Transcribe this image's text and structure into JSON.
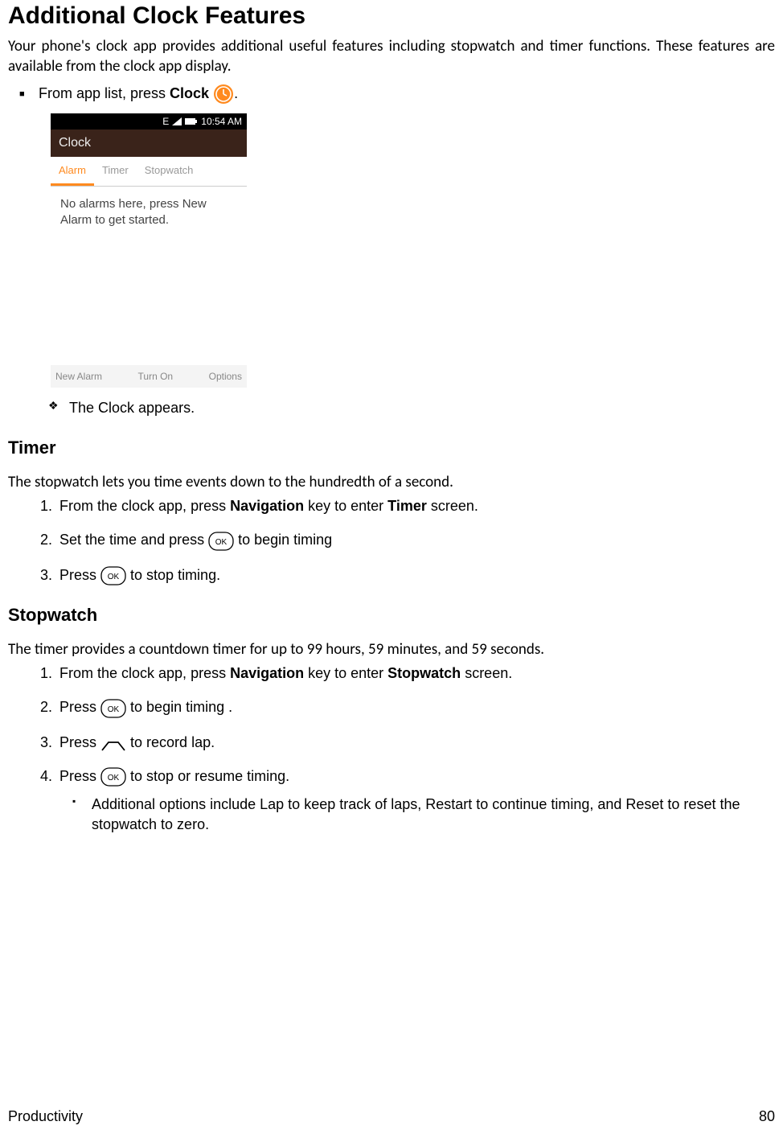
{
  "heading": "Additional Clock Features",
  "intro": "Your phone's clock app provides additional useful features including stopwatch and timer functions. These features are available from the clock app display.",
  "bullet_open_prefix": "From app list, press ",
  "bullet_open_bold": "Clock",
  "bullet_open_suffix": ".",
  "result1": "The Clock appears.",
  "mock": {
    "status_indicator": "E",
    "time": "10:54 AM",
    "title": "Clock",
    "tabs": [
      "Alarm",
      "Timer",
      "Stopwatch"
    ],
    "body": "No alarms here, press New Alarm to get started.",
    "softkeys": [
      "New Alarm",
      "Turn On",
      "Options"
    ]
  },
  "timer": {
    "heading": "Timer",
    "intro": "The stopwatch lets you time events down to the hundredth of a second.",
    "step1_a": "From the clock app, press ",
    "step1_b": "Navigation",
    "step1_c": " key to enter ",
    "step1_d": "Timer",
    "step1_e": " screen.",
    "step2_a": "Set the time and press ",
    "step2_b": " to begin timing",
    "step3_a": "Press ",
    "step3_b": " to stop timing."
  },
  "stopwatch": {
    "heading": "Stopwatch",
    "intro": "The timer provides a countdown timer for up to 99 hours, 59 minutes, and 59 seconds.",
    "step1_a": "From the clock app, press ",
    "step1_b": "Navigation",
    "step1_c": " key to enter ",
    "step1_d": "Stopwatch",
    "step1_e": " screen.",
    "step2_a": "Press ",
    "step2_b": " to begin timing .",
    "step3_a": "Press ",
    "step3_b": " to record lap.",
    "step4_a": "Press ",
    "step4_b": " to stop or resume timing.",
    "sub": "Additional options include Lap to keep track of laps, Restart to continue timing, and Reset to reset the stopwatch to zero."
  },
  "footer_left": "Productivity",
  "footer_right": "80"
}
